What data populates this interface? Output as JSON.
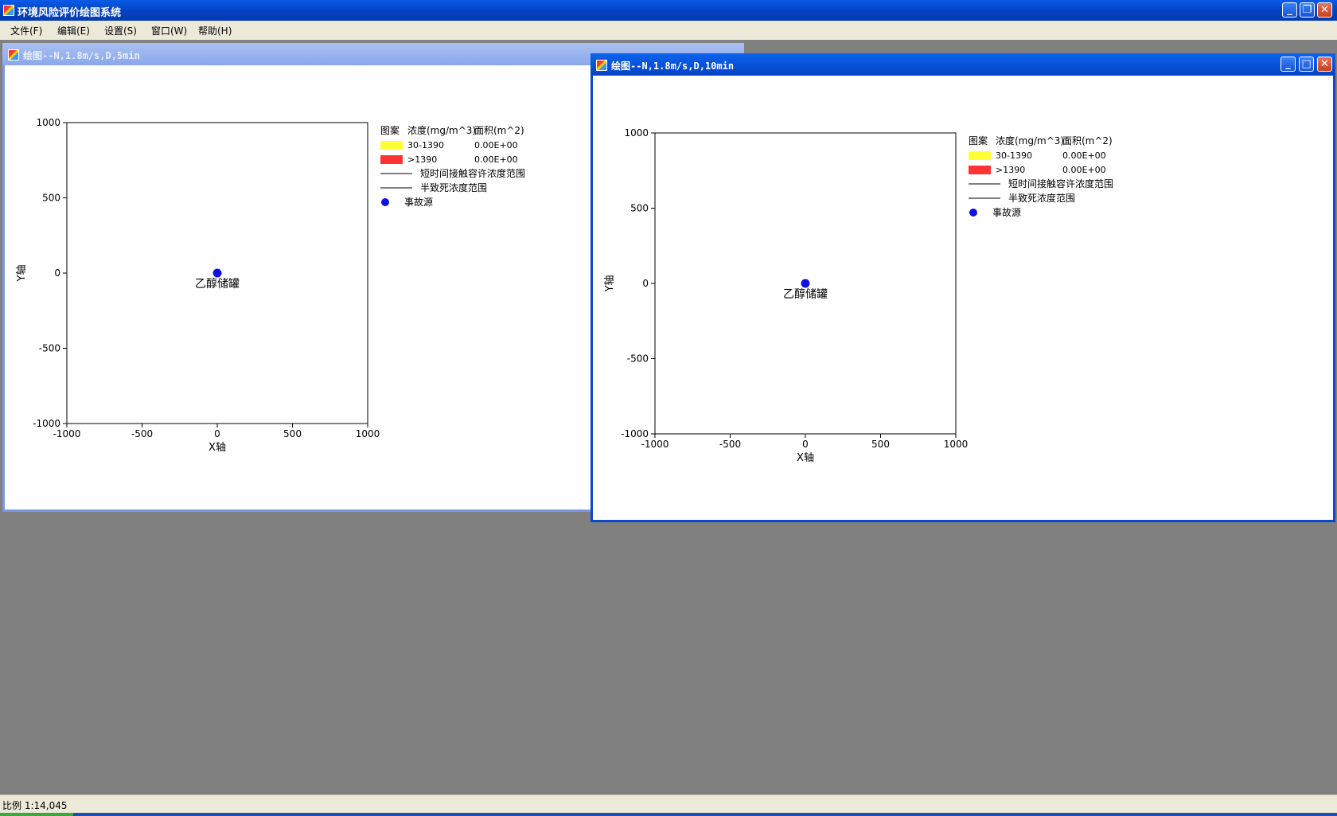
{
  "app": {
    "title": "环境风险评价绘图系统"
  },
  "menu": [
    "文件(F)",
    "编辑(E)",
    "设置(S)",
    "窗口(W)",
    "帮助(H)"
  ],
  "windows": [
    {
      "title": "绘图--N,1.8m/s,D,5min",
      "chart_data": {
        "type": "scatter",
        "xlabel": "X轴",
        "ylabel": "Y轴",
        "xlim": [
          -1000,
          1000
        ],
        "ylim": [
          -1000,
          1000
        ],
        "xticks": [
          "-1000",
          "-500",
          "0",
          "500",
          "1000"
        ],
        "yticks": [
          "1000",
          "500",
          "0",
          "-500",
          "-1000"
        ],
        "points": [
          {
            "x": 0,
            "y": 0,
            "label": "乙醇储罐",
            "color": "#1010e0"
          }
        ],
        "legend": {
          "headers": [
            "图案",
            "浓度(mg/m^3)",
            "面积(m^2)"
          ],
          "fills": [
            {
              "label": "30-1390",
              "area": "0.00E+00",
              "color": "#ffff33"
            },
            {
              "label": ">1390",
              "area": "0.00E+00",
              "color": "#ff3333"
            }
          ],
          "lines": [
            "短时间接触容许浓度范围",
            "半致死浓度范围"
          ],
          "marker": "事故源"
        }
      }
    },
    {
      "title": "绘图--N,1.8m/s,D,10min",
      "chart_data": {
        "type": "scatter",
        "xlabel": "X轴",
        "ylabel": "Y轴",
        "xlim": [
          -1000,
          1000
        ],
        "ylim": [
          -1000,
          1000
        ],
        "xticks": [
          "-1000",
          "-500",
          "0",
          "500",
          "1000"
        ],
        "yticks": [
          "1000",
          "500",
          "0",
          "-500",
          "-1000"
        ],
        "points": [
          {
            "x": 0,
            "y": 0,
            "label": "乙醇储罐",
            "color": "#1010e0"
          }
        ],
        "legend": {
          "headers": [
            "图案",
            "浓度(mg/m^3)",
            "面积(m^2)"
          ],
          "fills": [
            {
              "label": "30-1390",
              "area": "0.00E+00",
              "color": "#ffff33"
            },
            {
              "label": ">1390",
              "area": "0.00E+00",
              "color": "#ff3333"
            }
          ],
          "lines": [
            "短时间接触容许浓度范围",
            "半致死浓度范围"
          ],
          "marker": "事故源"
        }
      }
    }
  ],
  "status": {
    "scale": "比例 1:14,045"
  }
}
